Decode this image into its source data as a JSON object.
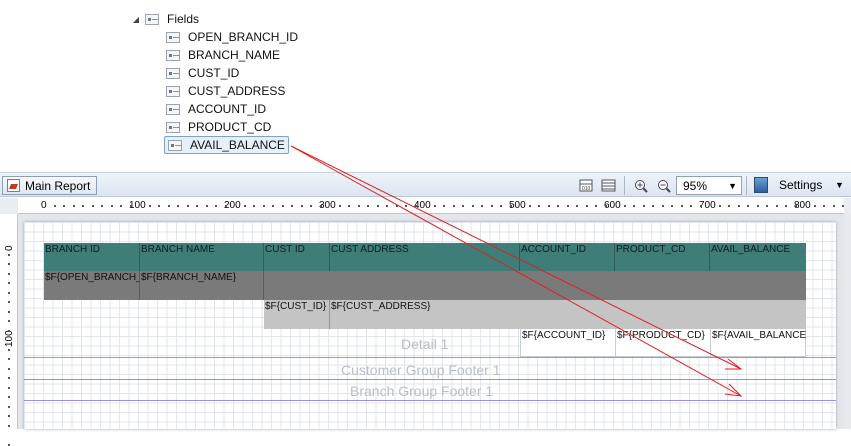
{
  "tree": {
    "root_label": "Fields",
    "fields": [
      {
        "label": "OPEN_BRANCH_ID"
      },
      {
        "label": "BRANCH_NAME"
      },
      {
        "label": "CUST_ID"
      },
      {
        "label": "CUST_ADDRESS"
      },
      {
        "label": "ACCOUNT_ID"
      },
      {
        "label": "PRODUCT_CD"
      },
      {
        "label": "AVAIL_BALANCE",
        "selected": true
      }
    ]
  },
  "toolbar": {
    "main_report_label": "Main Report",
    "zoom_value": "95%",
    "settings_label": "Settings",
    "icons": [
      "table-icon",
      "columns-icon",
      "zoom-in-icon",
      "zoom-out-icon",
      "settings-icon"
    ]
  },
  "ruler": {
    "labels": [
      "0",
      "100",
      "200",
      "300",
      "400",
      "500",
      "600",
      "700",
      "800"
    ],
    "vlabels": [
      "0",
      "100"
    ]
  },
  "report": {
    "column_header": [
      "BRANCH ID",
      "BRANCH NAME",
      "CUST ID",
      "CUST ADDRESS",
      "ACCOUNT_ID",
      "PRODUCT_CD",
      "AVAIL_BALANCE"
    ],
    "branch_group_header": {
      "open_branch_id": "$F{OPEN_BRANCH_ID}",
      "branch_name": "$F{BRANCH_NAME}"
    },
    "customer_group_header": {
      "cust_id": "$F{CUST_ID}",
      "cust_address": "$F{CUST_ADDRESS}"
    },
    "detail": {
      "account_id": "$F{ACCOUNT_ID}",
      "product_cd": "$F{PRODUCT_CD}",
      "avail_balance": "$F{AVAIL_BALANCE}"
    },
    "bands": {
      "detail": "Detail 1",
      "customer_footer": "Customer Group Footer 1",
      "branch_footer": "Branch Group Footer 1"
    }
  },
  "colors": {
    "column_header": "#3e7d78",
    "branch_group": "#7a7a7a",
    "customer_group": "#c4c4c4",
    "arrow": "#e02020",
    "band_line": "#9a93d8"
  }
}
